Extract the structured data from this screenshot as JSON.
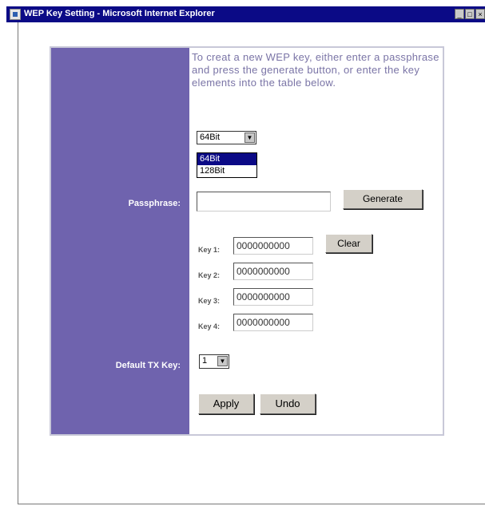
{
  "window": {
    "title": "WEP Key Setting - Microsoft Internet Explorer",
    "controls": {
      "minimize": "_",
      "maximize": "□",
      "close": "×"
    }
  },
  "intro_text": "To creat a new WEP key, either enter a passphrase and press the generate button, or enter the key elements into the table below.",
  "encryption": {
    "selected": "64Bit",
    "options": [
      "64Bit",
      "128Bit"
    ],
    "highlighted": "64Bit"
  },
  "passphrase": {
    "label": "Passphrase:",
    "value": "",
    "generate_label": "Generate"
  },
  "keys": [
    {
      "label": "Key 1:",
      "value": "0000000000"
    },
    {
      "label": "Key 2:",
      "value": "0000000000"
    },
    {
      "label": "Key 3:",
      "value": "0000000000"
    },
    {
      "label": "Key 4:",
      "value": "0000000000"
    }
  ],
  "clear_label": "Clear",
  "default_tx": {
    "label": "Default TX Key:",
    "value": "1"
  },
  "actions": {
    "apply_label": "Apply",
    "undo_label": "Undo"
  },
  "colors": {
    "titlebar": "#0b0a86",
    "left_panel": "#6f63ae",
    "intro_text": "#7a74a6"
  }
}
